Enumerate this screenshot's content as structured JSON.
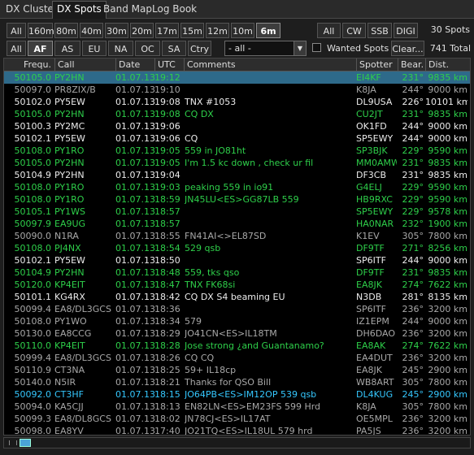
{
  "tabs": [
    {
      "label": "DX Cluster",
      "active": false
    },
    {
      "label": "DX Spots",
      "active": true
    },
    {
      "label": "Band Map",
      "active": false
    },
    {
      "label": "Log Book",
      "active": false
    }
  ],
  "band_buttons": [
    {
      "label": "All",
      "on": false
    },
    {
      "label": "160m",
      "on": false
    },
    {
      "label": "80m",
      "on": false
    },
    {
      "label": "40m",
      "on": false
    },
    {
      "label": "30m",
      "on": false
    },
    {
      "label": "20m",
      "on": false
    },
    {
      "label": "17m",
      "on": false
    },
    {
      "label": "15m",
      "on": false
    },
    {
      "label": "12m",
      "on": false
    },
    {
      "label": "10m",
      "on": false
    },
    {
      "label": "6m",
      "on": true
    }
  ],
  "mode_buttons": [
    {
      "label": "All",
      "on": false
    },
    {
      "label": "CW",
      "on": false
    },
    {
      "label": "SSB",
      "on": false
    },
    {
      "label": "DIGI",
      "on": false
    }
  ],
  "continent_buttons": [
    {
      "label": "All",
      "on": false
    },
    {
      "label": "AF",
      "on": true
    },
    {
      "label": "AS",
      "on": false
    },
    {
      "label": "EU",
      "on": false
    },
    {
      "label": "NA",
      "on": false
    },
    {
      "label": "OC",
      "on": false
    },
    {
      "label": "SA",
      "on": false
    },
    {
      "label": "Ctry",
      "on": false
    }
  ],
  "spots_count": "30 Spots",
  "total_count": "741 Total",
  "country_select": "- all -",
  "wanted_spots_label": "Wanted Spots",
  "clear_label": "Clear...",
  "columns": [
    "Frequ.",
    "Call",
    "Date",
    "UTC",
    "Comments",
    "Spotter",
    "Bear.",
    "Dist."
  ],
  "colors": {
    "green": "#2ecf4a",
    "white": "#ececec",
    "grey": "#a8a8a8",
    "cyan": "#35c8ff",
    "selected": "#2e6a8a"
  },
  "rows": [
    {
      "freq": "50105.0",
      "call": "PY2HN",
      "date": "01.07.13",
      "utc": "19:12",
      "comment": "",
      "spotter": "EI4KF",
      "bear": "231°",
      "dist": "9835 km",
      "color": "green",
      "selected": true
    },
    {
      "freq": "50097.0",
      "call": "PR8ZIX/B",
      "date": "01.07.13",
      "utc": "19:10",
      "comment": "",
      "spotter": "K8JA",
      "bear": "244°",
      "dist": "9000 km",
      "color": "grey"
    },
    {
      "freq": "50102.0",
      "call": "PY5EW",
      "date": "01.07.13",
      "utc": "19:08",
      "comment": "TNX #1053",
      "spotter": "DL9USA",
      "bear": "226°",
      "dist": "10101 km",
      "color": "white"
    },
    {
      "freq": "50105.0",
      "call": "PY2HN",
      "date": "01.07.13",
      "utc": "19:08",
      "comment": "CQ DX",
      "spotter": "CU2JT",
      "bear": "231°",
      "dist": "9835 km",
      "color": "green"
    },
    {
      "freq": "50100.3",
      "call": "PY2MC",
      "date": "01.07.13",
      "utc": "19:06",
      "comment": "",
      "spotter": "OK1FD",
      "bear": "244°",
      "dist": "9000 km",
      "color": "white"
    },
    {
      "freq": "50102.1",
      "call": "PY5EW",
      "date": "01.07.13",
      "utc": "19:06",
      "comment": "CQ",
      "spotter": "SP5EWY",
      "bear": "244°",
      "dist": "9000 km",
      "color": "white"
    },
    {
      "freq": "50108.0",
      "call": "PY1RO",
      "date": "01.07.13",
      "utc": "19:05",
      "comment": "559 in JO81ht",
      "spotter": "SP3BJK",
      "bear": "229°",
      "dist": "9590 km",
      "color": "green"
    },
    {
      "freq": "50105.0",
      "call": "PY2HN",
      "date": "01.07.13",
      "utc": "19:05",
      "comment": "I'm 1.5 kc down , check ur fil",
      "spotter": "MM0AMW",
      "bear": "231°",
      "dist": "9835 km",
      "color": "green"
    },
    {
      "freq": "50104.9",
      "call": "PY2HN",
      "date": "01.07.13",
      "utc": "19:04",
      "comment": "",
      "spotter": "DF3CB",
      "bear": "231°",
      "dist": "9835 km",
      "color": "white"
    },
    {
      "freq": "50108.0",
      "call": "PY1RO",
      "date": "01.07.13",
      "utc": "19:03",
      "comment": "peaking 559 in io91",
      "spotter": "G4ELJ",
      "bear": "229°",
      "dist": "9590 km",
      "color": "green"
    },
    {
      "freq": "50108.0",
      "call": "PY1RO",
      "date": "01.07.13",
      "utc": "18:59",
      "comment": "JN45LU<ES>GG87LB 559",
      "spotter": "HB9RXC",
      "bear": "229°",
      "dist": "9590 km",
      "color": "green"
    },
    {
      "freq": "50105.1",
      "call": "PY1WS",
      "date": "01.07.13",
      "utc": "18:57",
      "comment": "",
      "spotter": "SP5EWY",
      "bear": "229°",
      "dist": "9578 km",
      "color": "green"
    },
    {
      "freq": "50097.9",
      "call": "EA9UG",
      "date": "01.07.13",
      "utc": "18:57",
      "comment": "",
      "spotter": "HA0NAR",
      "bear": "232°",
      "dist": "1900 km",
      "color": "green"
    },
    {
      "freq": "50090.0",
      "call": "N1RA",
      "date": "01.07.13",
      "utc": "18:55",
      "comment": "FN41AI<>EL87SD",
      "spotter": "K1EV",
      "bear": "305°",
      "dist": "7800 km",
      "color": "grey"
    },
    {
      "freq": "50108.0",
      "call": "PJ4NX",
      "date": "01.07.13",
      "utc": "18:54",
      "comment": "529 qsb",
      "spotter": "DF9TF",
      "bear": "271°",
      "dist": "8256 km",
      "color": "green"
    },
    {
      "freq": "50102.1",
      "call": "PY5EW",
      "date": "01.07.13",
      "utc": "18:50",
      "comment": "",
      "spotter": "SP6ITF",
      "bear": "244°",
      "dist": "9000 km",
      "color": "white"
    },
    {
      "freq": "50104.9",
      "call": "PY2HN",
      "date": "01.07.13",
      "utc": "18:48",
      "comment": "559, tks qso",
      "spotter": "DF9TF",
      "bear": "231°",
      "dist": "9835 km",
      "color": "green"
    },
    {
      "freq": "50120.0",
      "call": "KP4EIT",
      "date": "01.07.13",
      "utc": "18:47",
      "comment": "TNX FK68si",
      "spotter": "EA8JK",
      "bear": "274°",
      "dist": "7622 km",
      "color": "green"
    },
    {
      "freq": "50101.1",
      "call": "KG4RX",
      "date": "01.07.13",
      "utc": "18:42",
      "comment": "CQ DX S4 beaming EU",
      "spotter": "N3DB",
      "bear": "281°",
      "dist": "8135 km",
      "color": "white"
    },
    {
      "freq": "50099.4",
      "call": "EA8/DL3GCS",
      "date": "01.07.13",
      "utc": "18:36",
      "comment": "",
      "spotter": "SP6ITF",
      "bear": "236°",
      "dist": "3200 km",
      "color": "grey"
    },
    {
      "freq": "50108.0",
      "call": "PY1WO",
      "date": "01.07.13",
      "utc": "18:34",
      "comment": "579",
      "spotter": "IZ1EPM",
      "bear": "244°",
      "dist": "9000 km",
      "color": "grey"
    },
    {
      "freq": "50130.0",
      "call": "EA8CCG",
      "date": "01.07.13",
      "utc": "18:29",
      "comment": "JO41CN<ES>IL18TM",
      "spotter": "DH6DAO",
      "bear": "236°",
      "dist": "3200 km",
      "color": "grey"
    },
    {
      "freq": "50110.0",
      "call": "KP4EIT",
      "date": "01.07.13",
      "utc": "18:28",
      "comment": "Jose strong  ¿and Guantanamo?",
      "spotter": "EA8AK",
      "bear": "274°",
      "dist": "7622 km",
      "color": "green"
    },
    {
      "freq": "50999.4",
      "call": "EA8/DL3GCS",
      "date": "01.07.13",
      "utc": "18:26",
      "comment": "CQ CQ",
      "spotter": "EA4DUT",
      "bear": "236°",
      "dist": "3200 km",
      "color": "grey"
    },
    {
      "freq": "50110.9",
      "call": "CT3NA",
      "date": "01.07.13",
      "utc": "18:25",
      "comment": "59+ IL18cp",
      "spotter": "EA8JK",
      "bear": "245°",
      "dist": "2900 km",
      "color": "grey"
    },
    {
      "freq": "50140.0",
      "call": "N5IR",
      "date": "01.07.13",
      "utc": "18:21",
      "comment": "Thanks for QSO Bill",
      "spotter": "WB8ART",
      "bear": "305°",
      "dist": "7800 km",
      "color": "grey"
    },
    {
      "freq": "50092.0",
      "call": "CT3HF",
      "date": "01.07.13",
      "utc": "18:15",
      "comment": "JO64PB<ES>IM12OP 539 qsb",
      "spotter": "DL4KUG",
      "bear": "245°",
      "dist": "2900 km",
      "color": "cyan"
    },
    {
      "freq": "50094.0",
      "call": "KA5CJJ",
      "date": "01.07.13",
      "utc": "18:13",
      "comment": "EN82LN<ES>EM23FS 599 Hrd",
      "spotter": "K8JA",
      "bear": "305°",
      "dist": "7800 km",
      "color": "grey"
    },
    {
      "freq": "50099.3",
      "call": "EA8/DL8GCS",
      "date": "01.07.13",
      "utc": "18:02",
      "comment": "JN78CJ<ES>IL17AT",
      "spotter": "OE5MPL",
      "bear": "236°",
      "dist": "3200 km",
      "color": "grey"
    },
    {
      "freq": "50098.0",
      "call": "EA8YV",
      "date": "01.07.13",
      "utc": "17:40",
      "comment": "JO21TQ<ES>IL18UL 579 hrd",
      "spotter": "PA5JS",
      "bear": "236°",
      "dist": "3200 km",
      "color": "grey"
    }
  ]
}
